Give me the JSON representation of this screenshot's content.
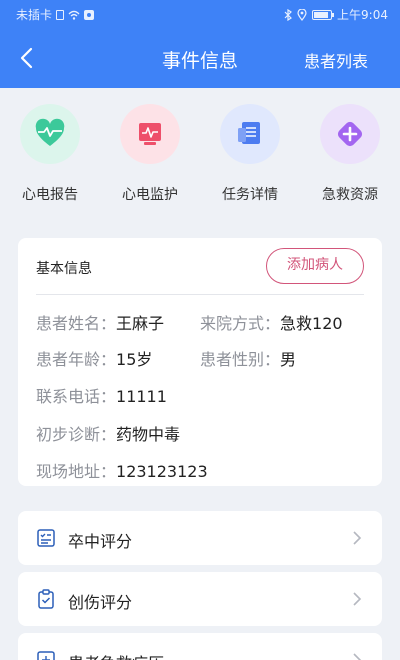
{
  "status_bar": {
    "carrier": "未插卡",
    "time": "上午9:04"
  },
  "header": {
    "title": "事件信息",
    "right_action": "患者列表"
  },
  "quick_actions": [
    {
      "label": "心电报告",
      "icon": "heart-pulse-icon",
      "color": "#3cc99a",
      "bg": "#dcf5ec"
    },
    {
      "label": "心电监护",
      "icon": "ecg-monitor-icon",
      "color": "#ee4f6a",
      "bg": "#fde2e7"
    },
    {
      "label": "任务详情",
      "icon": "task-document-icon",
      "color": "#4d7cf0",
      "bg": "#e0e8fd"
    },
    {
      "label": "急救资源",
      "icon": "medical-cross-icon",
      "color": "#a366f0",
      "bg": "#ece1fb"
    }
  ],
  "basic_info": {
    "title": "基本信息",
    "add_button": "添加病人",
    "patient_name": {
      "label": "患者姓名：",
      "value": "王麻子"
    },
    "arrival_method": {
      "label": "来院方式：",
      "value": "急救120"
    },
    "patient_age": {
      "label": "患者年龄：",
      "value": "15岁"
    },
    "patient_gender": {
      "label": "患者性别：",
      "value": "男"
    },
    "phone": {
      "label": "联系电话：",
      "value": "11111"
    },
    "diagnosis": {
      "label": "初步诊断：",
      "value": "药物中毒"
    },
    "address": {
      "label": "现场地址：",
      "value": "123123123"
    }
  },
  "menu": [
    {
      "label": "卒中评分",
      "icon": "stroke-score-icon"
    },
    {
      "label": "创伤评分",
      "icon": "trauma-clipboard-icon"
    },
    {
      "label": "患者急救病历",
      "icon": "emergency-record-icon"
    }
  ],
  "colors": {
    "primary": "#3e82f7",
    "accent": "#d2557a"
  }
}
